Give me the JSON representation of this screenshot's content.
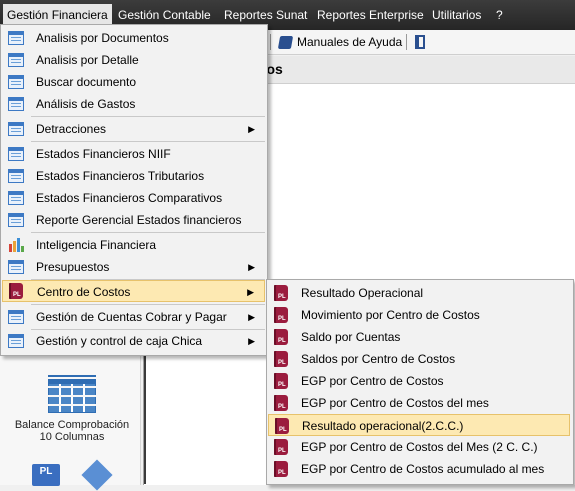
{
  "menubar": {
    "items": [
      "Gestión Financiera",
      "Gestión Contable",
      "Reportes Sunat",
      "Reportes Enterprise",
      "Utilitarios",
      "?"
    ]
  },
  "toolbar": {
    "help_label": "Manuales de Ayuda"
  },
  "window": {
    "title_fragment": "ctos"
  },
  "left_panel": {
    "tile_label": "Balance Comprobación 10 Columnas"
  },
  "financial_menu": {
    "items": [
      {
        "label": "Analisis por Documentos",
        "icon": "window-icon"
      },
      {
        "label": "Analisis por Detalle",
        "icon": "window-icon"
      },
      {
        "label": "Buscar documento",
        "icon": "window-icon"
      },
      {
        "label": "Análisis de Gastos",
        "icon": "window-icon"
      },
      {
        "label": "Detracciones",
        "icon": "window-icon",
        "submenu": true
      },
      {
        "label": "Estados Financieros NIIF",
        "icon": "window-icon"
      },
      {
        "label": "Estados Financieros Tributarios",
        "icon": "window-icon"
      },
      {
        "label": "Estados Financieros Comparativos",
        "icon": "window-icon"
      },
      {
        "label": "Reporte Gerencial Estados financieros",
        "icon": "window-icon"
      },
      {
        "label": "Inteligencia Financiera",
        "icon": "bar-chart-icon"
      },
      {
        "label": "Presupuestos",
        "icon": "window-icon",
        "submenu": true
      },
      {
        "label": "Centro de Costos",
        "icon": "pl-book-icon",
        "submenu": true,
        "highlighted": true
      },
      {
        "label": "Gestión de Cuentas Cobrar y Pagar",
        "icon": "window-icon",
        "submenu": true
      },
      {
        "label": "Gestión y control de caja Chica",
        "icon": "window-icon",
        "submenu": true
      }
    ]
  },
  "cost_center_submenu": {
    "items": [
      {
        "label": "Resultado Operacional",
        "icon": "pl-book-icon"
      },
      {
        "label": "Movimiento por Centro de Costos",
        "icon": "pl-book-icon"
      },
      {
        "label": "Saldo por Cuentas",
        "icon": "pl-book-icon"
      },
      {
        "label": "Saldos por Centro de Costos",
        "icon": "pl-book-icon"
      },
      {
        "label": "EGP por Centro de Costos",
        "icon": "pl-book-icon"
      },
      {
        "label": "EGP por Centro de Costos del mes",
        "icon": "pl-book-icon"
      },
      {
        "label": "Resultado operacional(2.C.C.)",
        "icon": "pl-book-icon",
        "highlighted": true
      },
      {
        "label": "EGP por Centro de Costos del Mes (2 C. C.)",
        "icon": "pl-book-icon"
      },
      {
        "label": "EGP por Centro de Costos acumulado al mes",
        "icon": "pl-book-icon"
      }
    ]
  },
  "colors": {
    "highlight": "#fde9b2",
    "highlight_border": "#e7c26b",
    "menubar": "#2e2e2e"
  }
}
